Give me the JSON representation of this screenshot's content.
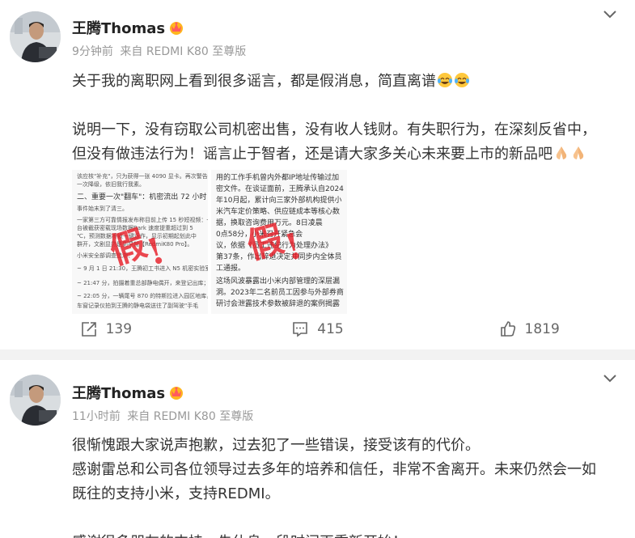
{
  "posts": [
    {
      "user": {
        "name": "王腾Thomas",
        "avatar_icon": "avatar-photo",
        "badge_icon": "vip-crown-icon"
      },
      "meta": {
        "time": "9分钟前",
        "source": "来自 REDMI K80 至尊版"
      },
      "text": [
        "关于我的离职网上看到很多谣言，都是假消息，简直离谱",
        "",
        "说明一下，没有窃取公司机密出售，没有收人钱财。有失职行为，在深刻反省中，",
        "但没有做违法行为！谣言止于智者，还是请大家多关心未来要上市的新品吧"
      ],
      "emoji": [
        "laugh-cry-emoji",
        "laugh-cry-emoji",
        "pray-emoji",
        "pray-emoji"
      ],
      "images": {
        "left": {
          "lines": [
            "该应核\"补充\"，只为获得一张 4090 显卡。再次警告，",
            "一次降级，依旧我行我素。",
            "二、重要一次\"翻车\"：机密流出 72 小时",
            "事件始末到了清三。",
            "一家第三方可靠情报发布称目前上传 15 秒短视频：一",
            "台被截获密载现场数据Rark 速度提重超过到 5",
            "℃，预测数据将被一键运作，显示初期起划此中",
            "群开，文剧显然是到早前【RedmiK80 Pro】。",
            "小米安全部调查追溯：",
            "~ 9 月 1 日 21:30，王腾初工书进入 N5 机密实验室；",
            "~ 21:47 分，拍摄着重总部静电偶开，来登记出库；",
            "~ 22:05 分，一辆尾号 870 的特斯拉进入园区地库，",
            "车窗记录仪拍到王腾的静电袋送往了副驾驶\"手毛"
          ],
          "stamps": [
            "假",
            "!"
          ]
        },
        "right": {
          "lines": [
            "用的工作手机曾内外都IP地址传输过加",
            "密文件。在谈证面前，王腾承认自2024",
            "年10月起，累计向三家外部机构提供小",
            "米汽车定价策略、供应链成本等核心数",
            "据，换取咨询费用万元。8日凌晨",
            "0点58分，小米召开紧急会",
            "议，依据《员工违纪行为处理办法》",
            "第37条，作出辞退决定并同步内全体员",
            "工通报。",
            "这场风波暴露出小米内部管理的深层漏",
            "洞。2023年二名前员工因参与外部券商",
            "研讨会泄露技术参数被辞退的案例揭露"
          ],
          "stamps": [
            "假",
            "!"
          ]
        }
      },
      "actions": [
        {
          "icon": "share-icon",
          "count": "139"
        },
        {
          "icon": "comment-icon",
          "count": "415"
        },
        {
          "icon": "like-icon",
          "count": "1819"
        }
      ]
    },
    {
      "user": {
        "name": "王腾Thomas",
        "avatar_icon": "avatar-photo",
        "badge_icon": "vip-crown-icon"
      },
      "meta": {
        "time": "11小时前",
        "source": "来自 REDMI K80 至尊版"
      },
      "text": [
        "很惭愧跟大家说声抱歉，过去犯了一些错误，接受该有的代价。",
        "感谢雷总和公司各位领导过去多年的培养和信任，非常不舍离开。未来仍然会一如",
        "既往的支持小米，支持REDMI。",
        "",
        "感谢很多朋友的支持，先休息一段时间再重新开始！"
      ]
    }
  ],
  "colors": {
    "accent": "#ff8200",
    "muted": "#999999",
    "stamp": "#e61e28"
  }
}
